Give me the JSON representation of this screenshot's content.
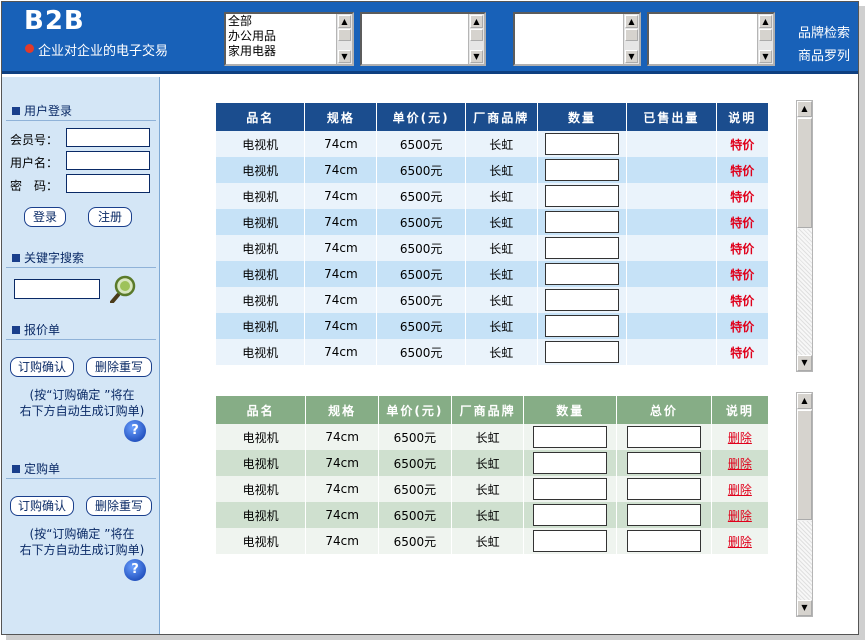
{
  "header": {
    "logo_title": "B2B",
    "logo_subtitle": "企业对企业的电子交易",
    "category_list": [
      "全部",
      "办公用品",
      "家用电器"
    ],
    "links": [
      "品牌检索",
      "商品罗列"
    ]
  },
  "sidebar": {
    "login": {
      "title": "用户登录",
      "member_label": "会员号：",
      "username_label": "用户名：",
      "password_label": "密　码：",
      "login_button": "登录",
      "register_button": "注册"
    },
    "search": {
      "title": "关键字搜索"
    },
    "quote": {
      "title": "报价单",
      "confirm_button": "订购确认",
      "reset_button": "删除重写",
      "note_line1": "(按“订购确定 ”将在",
      "note_line2": "右下方自动生成订购单)",
      "help": "?"
    },
    "order": {
      "title": "定购单",
      "confirm_button": "订购确认",
      "reset_button": "删除重写",
      "note_line1": "(按“订购确定 ”将在",
      "note_line2": "右下方自动生成订购单)",
      "help": "?"
    }
  },
  "quote_table": {
    "headers": [
      "品名",
      "规格",
      "单价(元)",
      "厂商品牌",
      "数量",
      "已售出量",
      "说明"
    ],
    "rows": [
      {
        "name": "电视机",
        "spec": "74cm",
        "price": "6500元",
        "brand": "长虹",
        "sold": "",
        "note": "特价"
      },
      {
        "name": "电视机",
        "spec": "74cm",
        "price": "6500元",
        "brand": "长虹",
        "sold": "",
        "note": "特价"
      },
      {
        "name": "电视机",
        "spec": "74cm",
        "price": "6500元",
        "brand": "长虹",
        "sold": "",
        "note": "特价"
      },
      {
        "name": "电视机",
        "spec": "74cm",
        "price": "6500元",
        "brand": "长虹",
        "sold": "",
        "note": "特价"
      },
      {
        "name": "电视机",
        "spec": "74cm",
        "price": "6500元",
        "brand": "长虹",
        "sold": "",
        "note": "特价"
      },
      {
        "name": "电视机",
        "spec": "74cm",
        "price": "6500元",
        "brand": "长虹",
        "sold": "",
        "note": "特价"
      },
      {
        "name": "电视机",
        "spec": "74cm",
        "price": "6500元",
        "brand": "长虹",
        "sold": "",
        "note": "特价"
      },
      {
        "name": "电视机",
        "spec": "74cm",
        "price": "6500元",
        "brand": "长虹",
        "sold": "",
        "note": "特价"
      },
      {
        "name": "电视机",
        "spec": "74cm",
        "price": "6500元",
        "brand": "长虹",
        "sold": "",
        "note": "特价"
      }
    ]
  },
  "order_table": {
    "headers": [
      "品名",
      "规格",
      "单价(元)",
      "厂商品牌",
      "数量",
      "总价",
      "说明"
    ],
    "rows": [
      {
        "name": "电视机",
        "spec": "74cm",
        "price": "6500元",
        "brand": "长虹",
        "action": "删除"
      },
      {
        "name": "电视机",
        "spec": "74cm",
        "price": "6500元",
        "brand": "长虹",
        "action": "删除"
      },
      {
        "name": "电视机",
        "spec": "74cm",
        "price": "6500元",
        "brand": "长虹",
        "action": "删除"
      },
      {
        "name": "电视机",
        "spec": "74cm",
        "price": "6500元",
        "brand": "长虹",
        "action": "删除"
      },
      {
        "name": "电视机",
        "spec": "74cm",
        "price": "6500元",
        "brand": "长虹",
        "action": "删除"
      }
    ]
  },
  "colors": {
    "header_blue": "#1861b8",
    "sidebar_bg": "#d4e6f6",
    "quote_header": "#1b4d8e",
    "order_header": "#86ad86",
    "accent_red": "#e0001b"
  }
}
